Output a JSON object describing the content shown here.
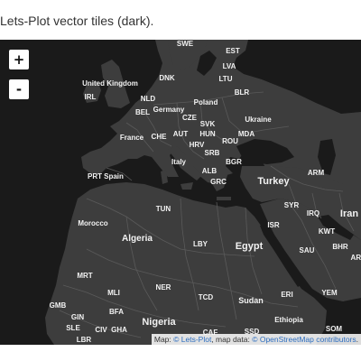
{
  "caption": "Lets-Plot vector tiles (dark).",
  "zoom": {
    "in_label": "+",
    "out_label": "-"
  },
  "attribution": {
    "prefix": "Map: ",
    "copyright": "©",
    "lets_plot_link": "Lets-Plot",
    "data_text": ", map data: ",
    "osm_link": "© OpenStreetMap contributors",
    "suffix": "."
  },
  "colors": {
    "land": "#3d3d3d",
    "water": "#1a1a1a",
    "border": "#5a5a5a",
    "label": "#f2f2f2"
  },
  "labels": [
    "SWE",
    "EST",
    "LVA",
    "DNK",
    "LTU",
    "United Kingdom",
    "IRL",
    "BLR",
    "NLD",
    "Poland",
    "BEL",
    "Germany",
    "CZE",
    "Ukraine",
    "SVK",
    "France",
    "CHE",
    "AUT",
    "HUN",
    "MDA",
    "HRV",
    "ROU",
    "SRB",
    "Italy",
    "BGR",
    "ALB",
    "PRT",
    "Spain",
    "GRC",
    "ARM",
    "Turkey",
    "TUN",
    "SYR",
    "IRQ",
    "Iran",
    "Morocco",
    "ISR",
    "KWT",
    "Algeria",
    "LBY",
    "Egypt",
    "SAU",
    "BHR",
    "ARE",
    "MRT",
    "MLI",
    "NER",
    "TCD",
    "Sudan",
    "ERI",
    "YEM",
    "GMB",
    "BFA",
    "GIN",
    "SLE",
    "CIV",
    "GHA",
    "Nigeria",
    "Ethiopia",
    "SOM",
    "LBR",
    "SSD",
    "CAF"
  ]
}
